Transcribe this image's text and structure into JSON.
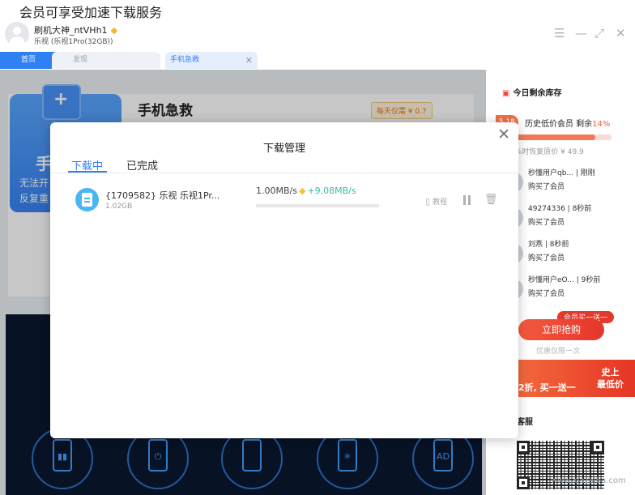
{
  "caption": "会员可享受加速下载服务",
  "user": {
    "name": "刷机大神_ntVHh1",
    "vip_icon": "diamond-icon",
    "device": "乐视 (乐视1Pro(32GB))"
  },
  "window_controls": [
    "menu-icon",
    "minimize-icon",
    "maximize-icon",
    "close-icon"
  ],
  "tabs": [
    {
      "label": "首页"
    },
    {
      "label": "发现"
    },
    {
      "label": "手机急救"
    }
  ],
  "feature": {
    "title": "手机急救",
    "badge": "每天仅需 ¥ 0.7",
    "card_big": "手",
    "card_line1": "无法开",
    "card_line2": "反复重"
  },
  "sidebar": {
    "header": "今日剩余库存",
    "discount": "5.18",
    "history_label": "历史低价会员 剩余",
    "history_pct_text": "14%",
    "history_pct": 0.86,
    "restore_text": "存为0%时恢复原价 ¥ 49.9",
    "buyers": [
      {
        "name": "秒懂用户qb... | 刚刚",
        "action": "购买了会员"
      },
      {
        "name": "49274336 | 8秒前",
        "action": "购买了会员"
      },
      {
        "name": "刘燕 | 8秒前",
        "action": "购买了会员"
      },
      {
        "name": "秒懂用户eO... | 9秒前",
        "action": "购买了会员"
      }
    ],
    "promo_tag": "会员买一送一",
    "buy_button": "立即抢购",
    "once_text": "优惠仅限一次",
    "banner_left": "2折, 买一送一",
    "banner_right_1": "史上",
    "banner_right_2": "最低价",
    "service": "客服"
  },
  "modal": {
    "title": "下载管理",
    "tab_downloading": "下载中",
    "tab_completed": "已完成",
    "close_icon": "close-icon",
    "item": {
      "name": "{1709582} 乐视 乐视1Pr...",
      "size": "1.02GB",
      "speed": "1.00MB/s",
      "boost": "+9.08MB/s",
      "progress": 0,
      "tutorial": "教程"
    }
  },
  "watermark": "www.xiazaiba.com",
  "colors": {
    "accent": "#2f7ff5",
    "promo_red": "#e6352a",
    "vip_gold": "#f6c33a",
    "boost_teal": "#3fb8a3"
  }
}
